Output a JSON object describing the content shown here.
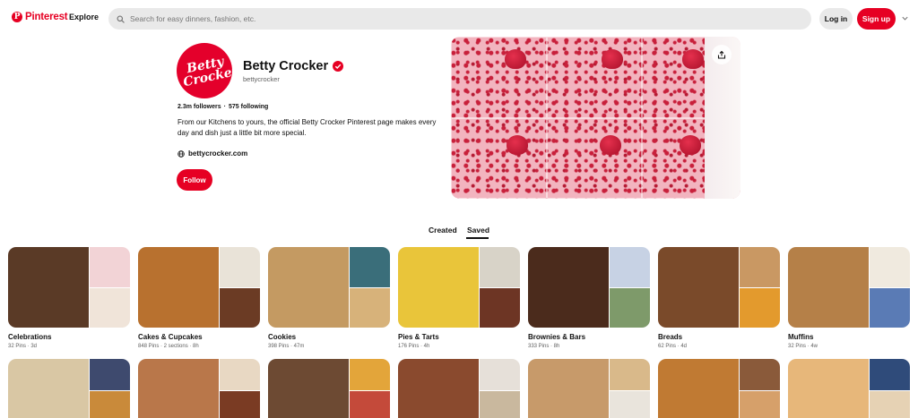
{
  "header": {
    "logo_text": "Pinterest",
    "explore_label": "Explore",
    "search_placeholder": "Search for easy dinners, fashion, etc.",
    "login_label": "Log in",
    "signup_label": "Sign up"
  },
  "profile": {
    "avatar_text_line1": "Betty",
    "avatar_text_line2": "Crocker",
    "name": "Betty Crocker",
    "handle": "bettycrocker",
    "followers": "2.3m followers",
    "separator": "·",
    "following": "575 following",
    "bio": "From our Kitchens to yours, the official Betty Crocker Pinterest page makes every day and dish just a little bit more special.",
    "website": "bettycrocker.com",
    "follow_label": "Follow"
  },
  "tabs": {
    "created": "Created",
    "saved": "Saved",
    "active": "saved"
  },
  "boards": [
    {
      "title": "Celebrations",
      "meta": "32 Pins · 3d",
      "colors": [
        "#5a3a26",
        "#f2d3d6",
        "#f0e4d9"
      ]
    },
    {
      "title": "Cakes & Cupcakes",
      "meta": "848 Pins · 2 sections · 8h",
      "colors": [
        "#b8712f",
        "#e9e3d8",
        "#6b3b24"
      ]
    },
    {
      "title": "Cookies",
      "meta": "398 Pins · 47m",
      "colors": [
        "#c49a62",
        "#3a6e7a",
        "#d7b27a"
      ]
    },
    {
      "title": "Pies & Tarts",
      "meta": "176 Pins · 4h",
      "colors": [
        "#e9c53a",
        "#d8d3c8",
        "#6d3524"
      ]
    },
    {
      "title": "Brownies & Bars",
      "meta": "333 Pins · 8h",
      "colors": [
        "#4b2b1c",
        "#c7d2e4",
        "#7e9a6a"
      ]
    },
    {
      "title": "Breads",
      "meta": "62 Pins · 4d",
      "colors": [
        "#7a4a2a",
        "#c99863",
        "#e39a2d"
      ]
    },
    {
      "title": "Muffins",
      "meta": "32 Pins · 4w",
      "colors": [
        "#b58048",
        "#f0eadf",
        "#5a7bb5"
      ]
    }
  ],
  "boards_row2": [
    {
      "colors": [
        "#d9c7a4",
        "#3e4a6e",
        "#c98a3a"
      ]
    },
    {
      "colors": [
        "#b9774a",
        "#e8d8c3",
        "#7a3b23"
      ]
    },
    {
      "colors": [
        "#6d4a33",
        "#e3a53a",
        "#c44a3a"
      ]
    },
    {
      "colors": [
        "#8a4a2e",
        "#e6e0d9",
        "#c9b89e"
      ]
    },
    {
      "colors": [
        "#c79a6a",
        "#d9b98a",
        "#e9e4dc"
      ]
    },
    {
      "colors": [
        "#c07a33",
        "#8a5a3a",
        "#d6a06a"
      ]
    },
    {
      "colors": [
        "#e7b77a",
        "#2f4b7a",
        "#e6d2b4"
      ]
    }
  ],
  "accent": "#e60023"
}
